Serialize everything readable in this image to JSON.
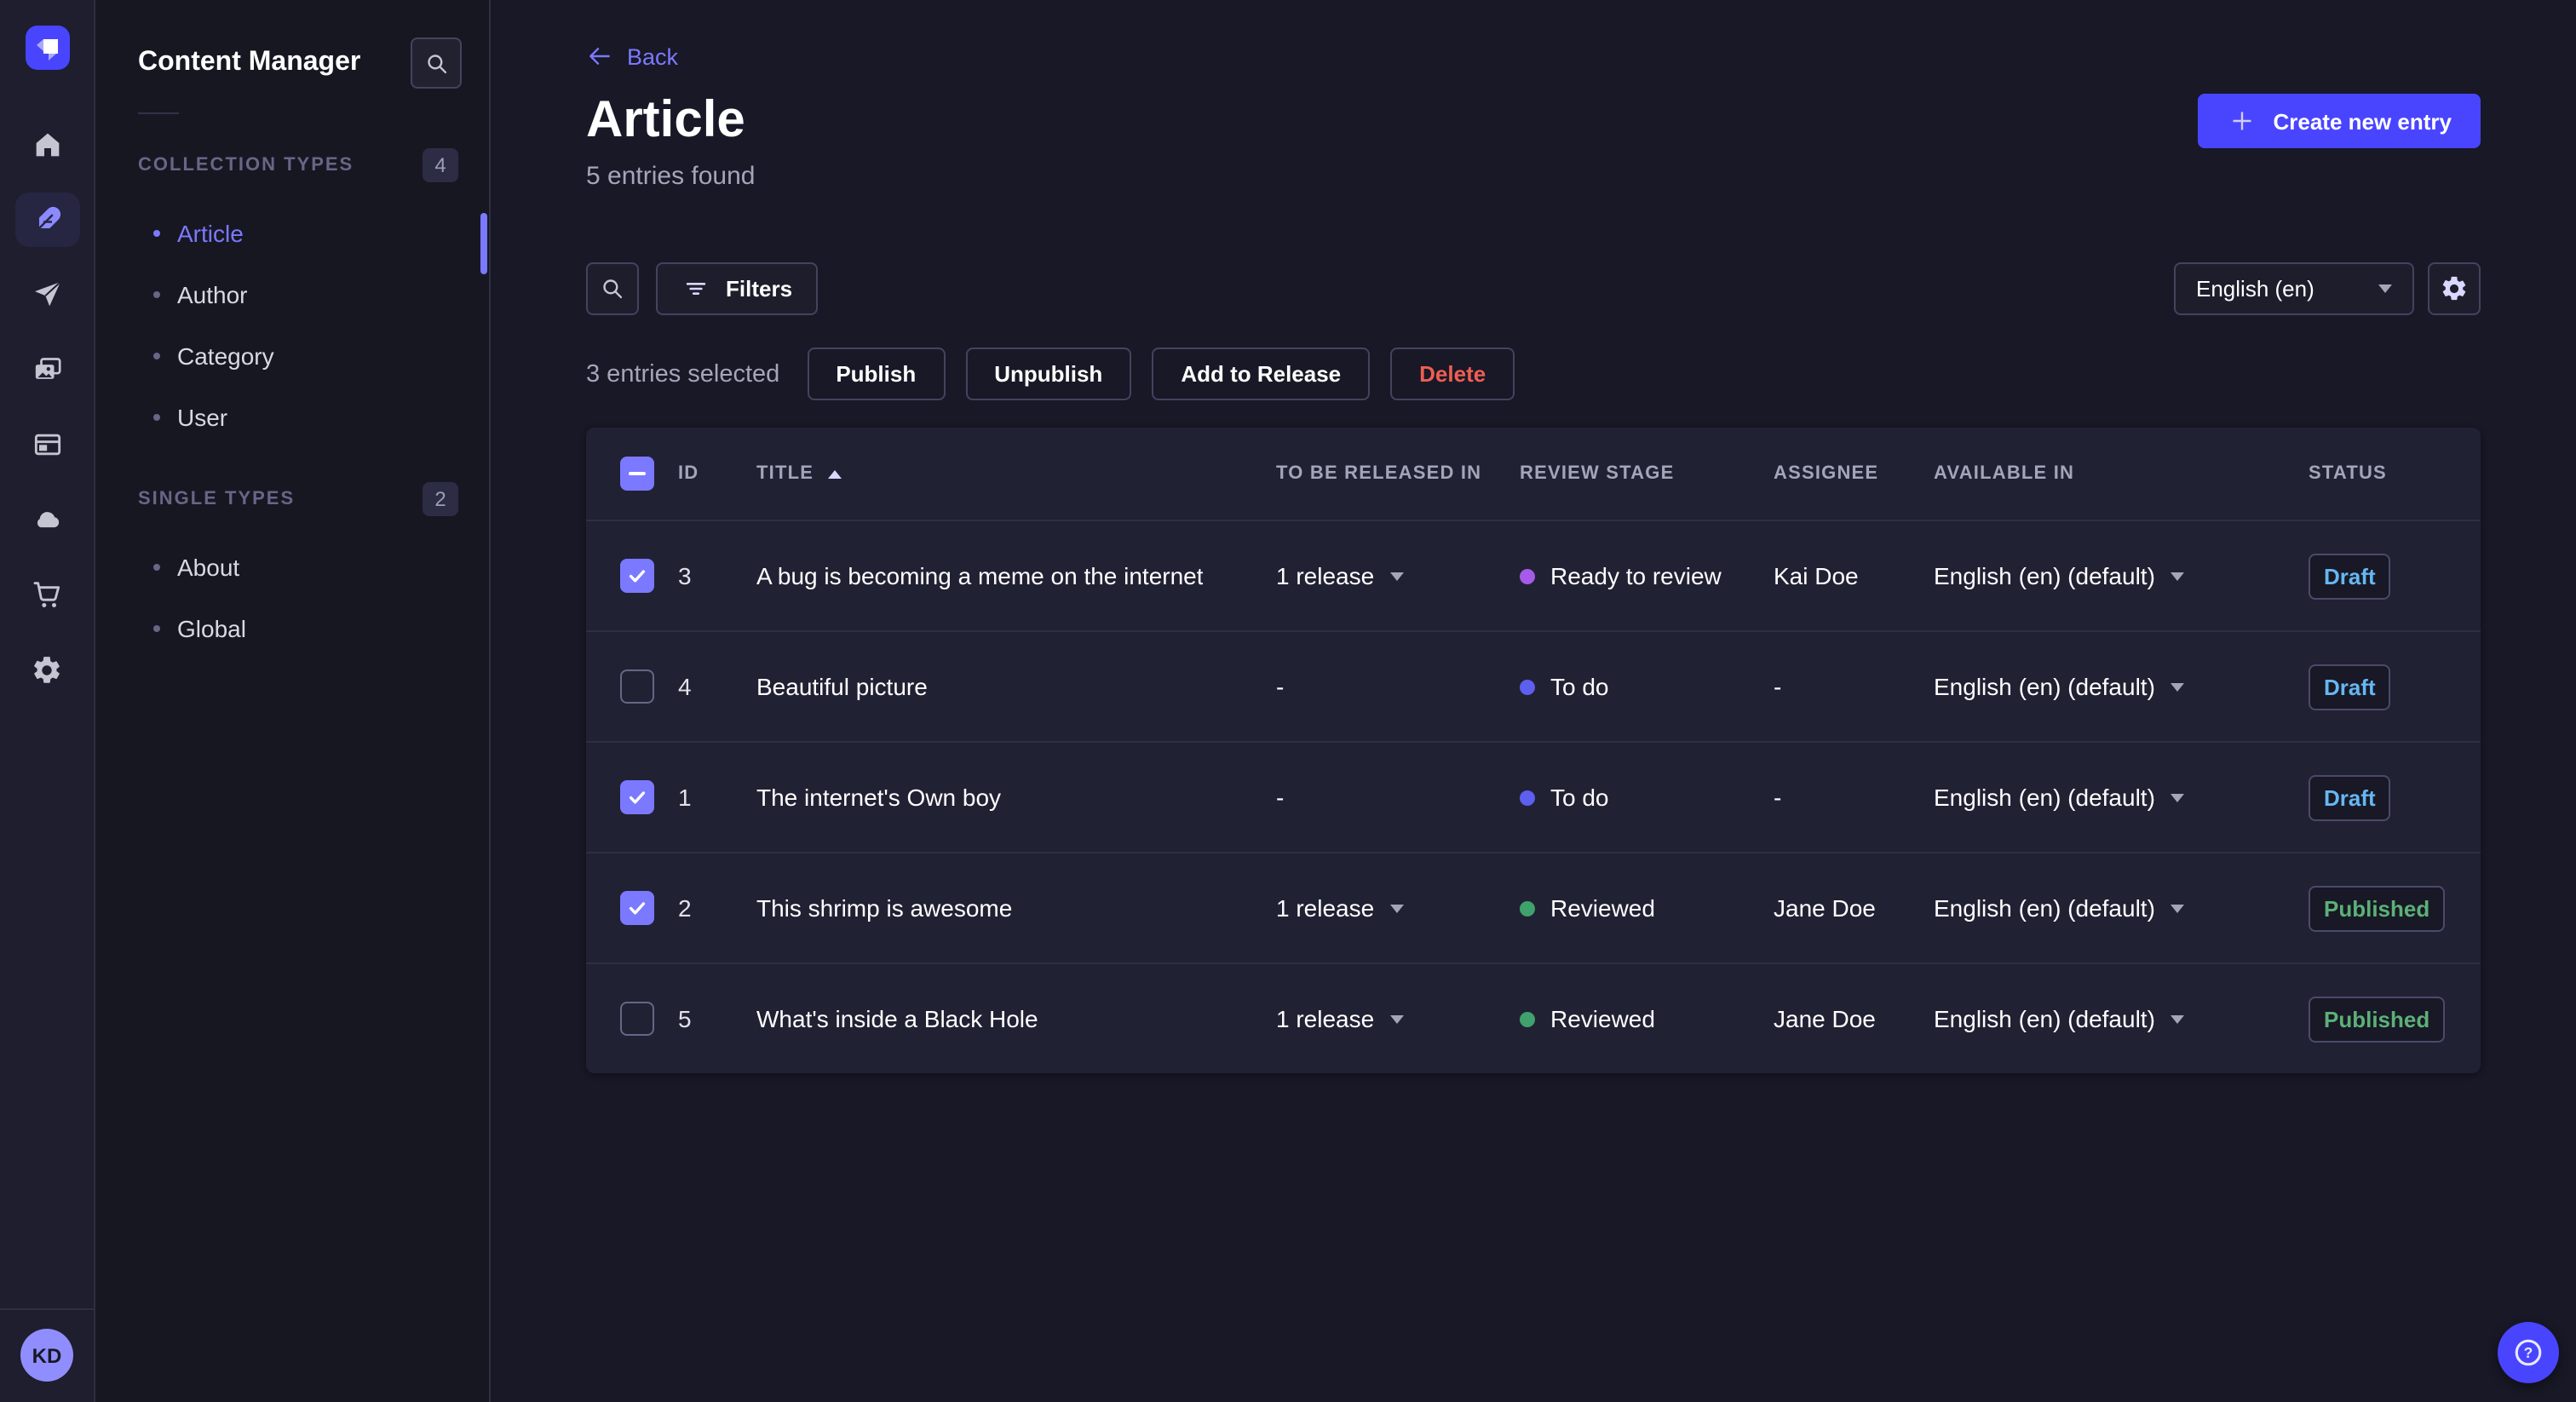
{
  "colors": {
    "accent": "#4945ff",
    "accent_light": "#7b79ff",
    "page_bg": "#181826",
    "panel_bg": "#212134",
    "draft_text": "#66b7f1",
    "published_text": "#5cb176",
    "delete_text": "#ee5e52"
  },
  "nav": {
    "avatar_initials": "KD",
    "items": [
      {
        "name": "home",
        "icon": "home-icon",
        "active": false
      },
      {
        "name": "content-manager",
        "icon": "feather-icon",
        "active": true
      },
      {
        "name": "releases",
        "icon": "paper-plane-icon",
        "active": false
      },
      {
        "name": "media-library",
        "icon": "images-icon",
        "active": false
      },
      {
        "name": "content-type-builder",
        "icon": "layout-icon",
        "active": false
      },
      {
        "name": "deploy",
        "icon": "cloud-icon",
        "active": false
      },
      {
        "name": "marketplace",
        "icon": "cart-icon",
        "active": false
      },
      {
        "name": "settings",
        "icon": "gear-icon",
        "active": false
      }
    ]
  },
  "subnav": {
    "title": "Content Manager",
    "search_icon": "search-icon",
    "sections": [
      {
        "label": "COLLECTION TYPES",
        "badge": "4",
        "items": [
          {
            "label": "Article",
            "active": true
          },
          {
            "label": "Author",
            "active": false
          },
          {
            "label": "Category",
            "active": false
          },
          {
            "label": "User",
            "active": false
          }
        ]
      },
      {
        "label": "SINGLE TYPES",
        "badge": "2",
        "items": [
          {
            "label": "About",
            "active": false
          },
          {
            "label": "Global",
            "active": false
          }
        ]
      }
    ]
  },
  "header": {
    "back_label": "Back",
    "title": "Article",
    "subtitle": "5 entries found",
    "create_label": "Create new entry"
  },
  "toolbar": {
    "search_icon": "search-icon",
    "filters_label": "Filters",
    "locale_value": "English (en)",
    "settings_icon": "gear-icon"
  },
  "selection": {
    "text": "3 entries selected",
    "publish_label": "Publish",
    "unpublish_label": "Unpublish",
    "add_to_release_label": "Add to Release",
    "delete_label": "Delete"
  },
  "table": {
    "header_checkbox_state": "indeterminate",
    "sort_column": "TITLE",
    "sort_direction": "asc",
    "columns": {
      "id": "ID",
      "title": "TITLE",
      "released": "TO BE RELEASED IN",
      "stage": "REVIEW STAGE",
      "assignee": "ASSIGNEE",
      "available": "AVAILABLE IN",
      "status": "STATUS"
    },
    "rows": [
      {
        "selected": true,
        "id": "3",
        "title": "A bug is becoming a meme on the internet",
        "released": "1 release",
        "released_menu": true,
        "stage": "Ready to review",
        "stage_color": "#a65ae8",
        "assignee": "Kai Doe",
        "available": "English (en) (default)",
        "status": "Draft",
        "status_kind": "draft"
      },
      {
        "selected": false,
        "id": "4",
        "title": "Beautiful picture",
        "released": "-",
        "released_menu": false,
        "stage": "To do",
        "stage_color": "#5d5fef",
        "assignee": "-",
        "available": "English (en) (default)",
        "status": "Draft",
        "status_kind": "draft"
      },
      {
        "selected": true,
        "id": "1",
        "title": "The internet's Own boy",
        "released": "-",
        "released_menu": false,
        "stage": "To do",
        "stage_color": "#5d5fef",
        "assignee": "-",
        "available": "English (en) (default)",
        "status": "Draft",
        "status_kind": "draft"
      },
      {
        "selected": true,
        "id": "2",
        "title": "This shrimp is awesome",
        "released": "1 release",
        "released_menu": true,
        "stage": "Reviewed",
        "stage_color": "#3fa26c",
        "assignee": "Jane Doe",
        "available": "English (en) (default)",
        "status": "Published",
        "status_kind": "published"
      },
      {
        "selected": false,
        "id": "5",
        "title": "What's inside a Black Hole",
        "released": "1 release",
        "released_menu": true,
        "stage": "Reviewed",
        "stage_color": "#3fa26c",
        "assignee": "Jane Doe",
        "available": "English (en) (default)",
        "status": "Published",
        "status_kind": "published"
      }
    ]
  },
  "help": {
    "icon": "question-mark-icon"
  }
}
